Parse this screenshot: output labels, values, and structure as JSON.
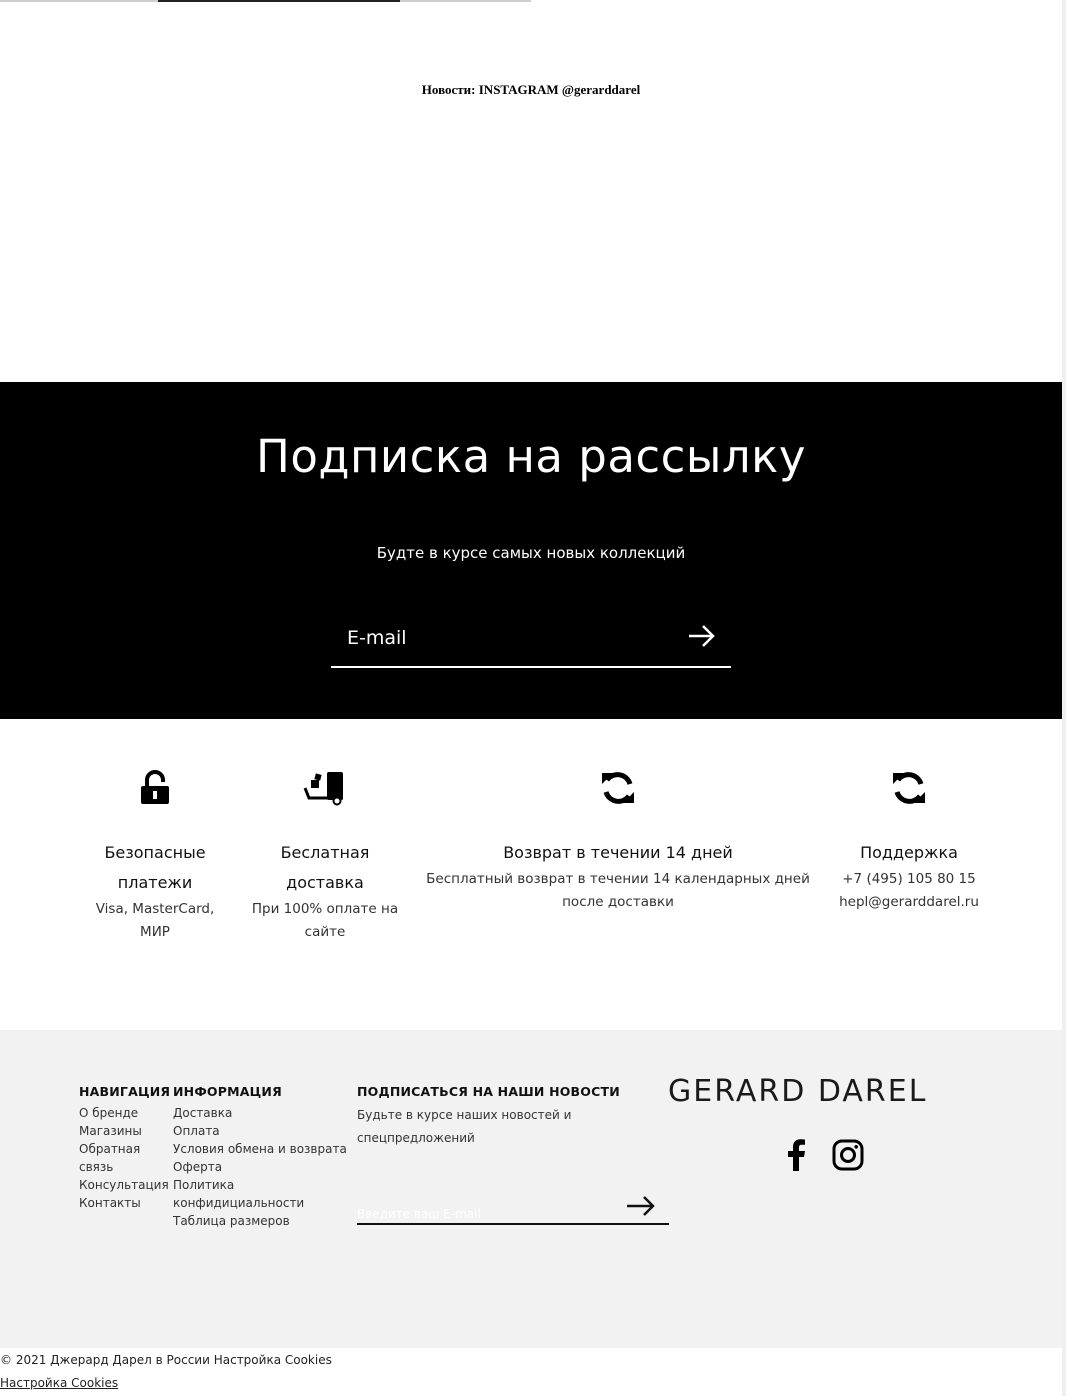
{
  "instagram": {
    "title": "Новости: INSTAGRAM @gerarddarel"
  },
  "subscribe": {
    "title": "Подписка на рассылку",
    "subtitle": "Будте в курсе самых новых коллекций",
    "placeholder": "E-mail",
    "submit_icon": "arrow-right-icon"
  },
  "features": [
    {
      "icon": "unlock-icon",
      "title_line1": "Безопасные",
      "title_line2": "платежи",
      "desc_line1": "Visa, MasterCard,",
      "desc_line2": "МИР"
    },
    {
      "icon": "delivery-truck-icon",
      "title_line1": "Беслатная",
      "title_line2": "доставка",
      "desc_line1": "При 100% оплате на",
      "desc_line2": "сайте"
    },
    {
      "icon": "refresh-icon",
      "title_line1": "Возврат в течении 14 дней",
      "desc_line1": "Бесплатный возврат в течении 14 календарных дней",
      "desc_line2": "после доставки"
    },
    {
      "icon": "refresh-icon",
      "title_line1": "Поддержка",
      "desc_line1": "+7 (495) 105 80 15",
      "desc_line2": "hepl@gerarddarel.ru"
    }
  ],
  "footer": {
    "navigation": {
      "title": "НАВИГАЦИЯ",
      "links": [
        "О бренде",
        "Магазины",
        "Обратная",
        "связь",
        "Консультация",
        "Контакты"
      ]
    },
    "information": {
      "title": "ИНФОРМАЦИЯ",
      "links": [
        "Доставка",
        "Оплата",
        "Условия обмена и возврата",
        "Оферта",
        "Политика",
        "конфидициальности",
        "Таблица размеров"
      ]
    },
    "newsletter": {
      "title": "ПОДПИСАТЬСЯ НА НАШИ НОВОСТИ",
      "text": "Будьте в курсе наших новостей и спецпредложений",
      "placeholder": "Введите ваш E-mail"
    },
    "logo": "GERARD DAREL",
    "social": [
      "facebook-icon",
      "instagram-icon"
    ]
  },
  "bottom": {
    "copyright": "© 2021 Джерард Дарел в России Настройка Cookies",
    "cookies_link": "Настройка Cookies"
  },
  "colors": {
    "dark": "#000000",
    "footer_bg": "#f2f2f2",
    "text": "#111111"
  }
}
